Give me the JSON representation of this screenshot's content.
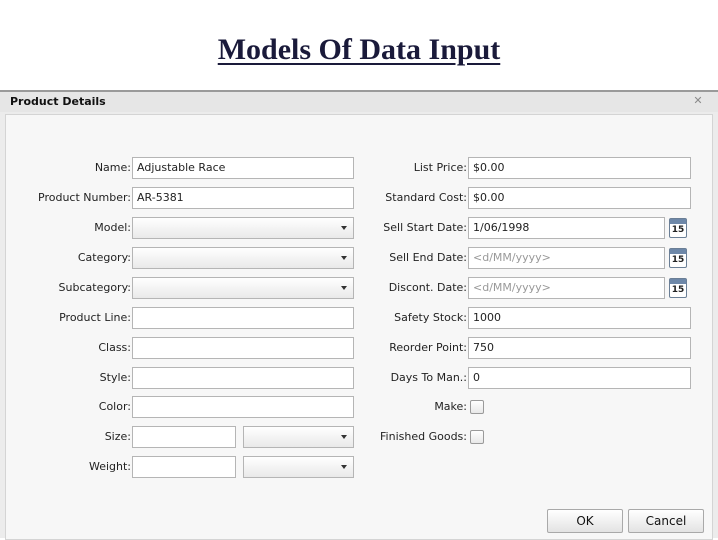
{
  "slide": {
    "title": "Models Of Data Input"
  },
  "dialog": {
    "title": "Product Details",
    "close_icon": "close-icon"
  },
  "left": {
    "name": {
      "label": "Name:",
      "value": "Adjustable Race"
    },
    "product_number": {
      "label": "Product Number:",
      "value": "AR-5381"
    },
    "model": {
      "label": "Model:",
      "value": ""
    },
    "category": {
      "label": "Category:",
      "value": ""
    },
    "subcategory": {
      "label": "Subcategory:",
      "value": ""
    },
    "product_line": {
      "label": "Product Line:",
      "value": ""
    },
    "class": {
      "label": "Class:",
      "value": ""
    },
    "style": {
      "label": "Style:",
      "value": ""
    },
    "color": {
      "label": "Color:",
      "value": ""
    },
    "size": {
      "label": "Size:",
      "value": "",
      "unit": ""
    },
    "weight": {
      "label": "Weight:",
      "value": "",
      "unit": ""
    }
  },
  "right": {
    "list_price": {
      "label": "List Price:",
      "value": "$0.00"
    },
    "standard_cost": {
      "label": "Standard Cost:",
      "value": "$0.00"
    },
    "sell_start_date": {
      "label": "Sell Start Date:",
      "value": "1/06/1998",
      "calendar_day": "15"
    },
    "sell_end_date": {
      "label": "Sell End Date:",
      "placeholder": "<d/MM/yyyy>",
      "calendar_day": "15"
    },
    "discont_date": {
      "label": "Discont. Date:",
      "placeholder": "<d/MM/yyyy>",
      "calendar_day": "15"
    },
    "safety_stock": {
      "label": "Safety Stock:",
      "value": "1000"
    },
    "reorder_point": {
      "label": "Reorder Point:",
      "value": "750"
    },
    "days_to_man": {
      "label": "Days To Man.:",
      "value": "0"
    },
    "make": {
      "label": "Make:",
      "checked": false
    },
    "finished_goods": {
      "label": "Finished Goods:",
      "checked": false
    }
  },
  "buttons": {
    "ok": "OK",
    "cancel": "Cancel"
  }
}
